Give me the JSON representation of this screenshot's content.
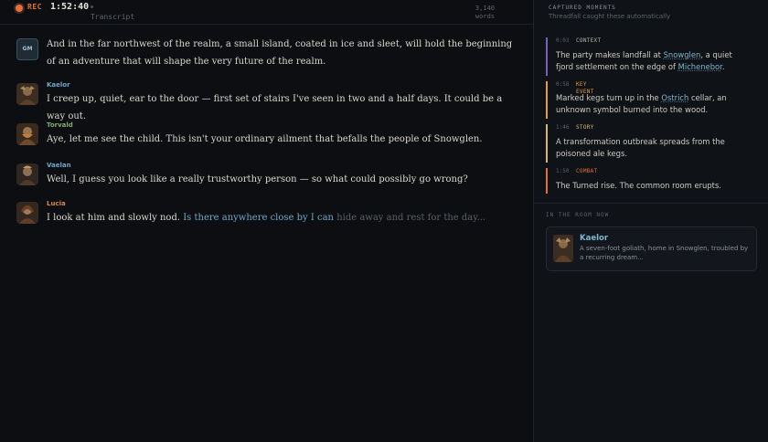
{
  "topbar": {
    "rec_label": "REC",
    "timer": "1:52:40",
    "view_label": "Transcript",
    "word_count": "3,140",
    "word_unit": "words"
  },
  "transcript": {
    "messages": [
      {
        "speaker": "GM",
        "avatar_icon": "gm-badge-icon",
        "color": "#9fc4d6",
        "text": "And in the far northwest of the realm, a small island, coated in ice and sleet, will hold the beginning of an adventure that will shape the very future of the realm."
      },
      {
        "speaker": "Kaelor",
        "avatar_icon": "character-portrait-icon",
        "color": "#6fa9c8",
        "text": "I creep up, quiet, ear to the door — first set of stairs I've seen in two and a half days. It could be a way out."
      },
      {
        "speaker": "Torvald",
        "avatar_icon": "character-portrait-icon",
        "color": "#7fae6a",
        "text": "Aye, let me see the child. This isn't your ordinary ailment that befalls the people of Snowglen."
      },
      {
        "speaker": "Vaelan",
        "avatar_icon": "character-portrait-icon",
        "color": "#6fa9c8",
        "text": "Well, I guess you look like a really trustworthy person — so what could possibly go wrong?"
      },
      {
        "speaker": "Lucia",
        "avatar_icon": "character-portrait-icon",
        "color": "#d98a50",
        "text_plain": "I look at him and slowly nod.",
        "text_live": "Is there anywhere close by I can",
        "text_fading": "hide away and rest for the day..."
      }
    ]
  },
  "moments": {
    "title": "CAPTURED MOMENTS",
    "subtitle": "Threadfall caught these automatically",
    "items": [
      {
        "time": "0:03",
        "tag": "CONTEXT",
        "tag_color": "#b9b6ae",
        "bar_color": "#7a5fc0",
        "before": "The party makes landfall at ",
        "link1": "Snowglen",
        "middle": ", a quiet fjord settlement on the edge of ",
        "link2": "Michenebor",
        "after": "."
      },
      {
        "time": "0:58",
        "tag": "KEY EVENT",
        "tag_color": "#e0a040",
        "bar_color": "#e0a040",
        "before": "Marked kegs turn up in the ",
        "link1": "Ostrich",
        "middle": " cellar, an unknown symbol burned into the wood.",
        "link2": "",
        "after": ""
      },
      {
        "time": "1:46",
        "tag": "STORY",
        "tag_color": "#d9b57a",
        "bar_color": "#d9b57a",
        "before": "A transformation outbreak spreads from the poisoned ale kegs.",
        "link1": "",
        "middle": "",
        "link2": "",
        "after": ""
      },
      {
        "time": "1:50",
        "tag": "COMBAT",
        "tag_color": "#e07040",
        "bar_color": "#e07040",
        "before": "The Turned rise. The common room erupts.",
        "link1": "",
        "middle": "",
        "link2": "",
        "after": ""
      }
    ]
  },
  "room": {
    "title": "IN THE ROOM NOW",
    "npc_name": "Kaelor",
    "npc_desc": "A seven-foot goliath, home in Snowglen, troubled by a recurring dream..."
  }
}
